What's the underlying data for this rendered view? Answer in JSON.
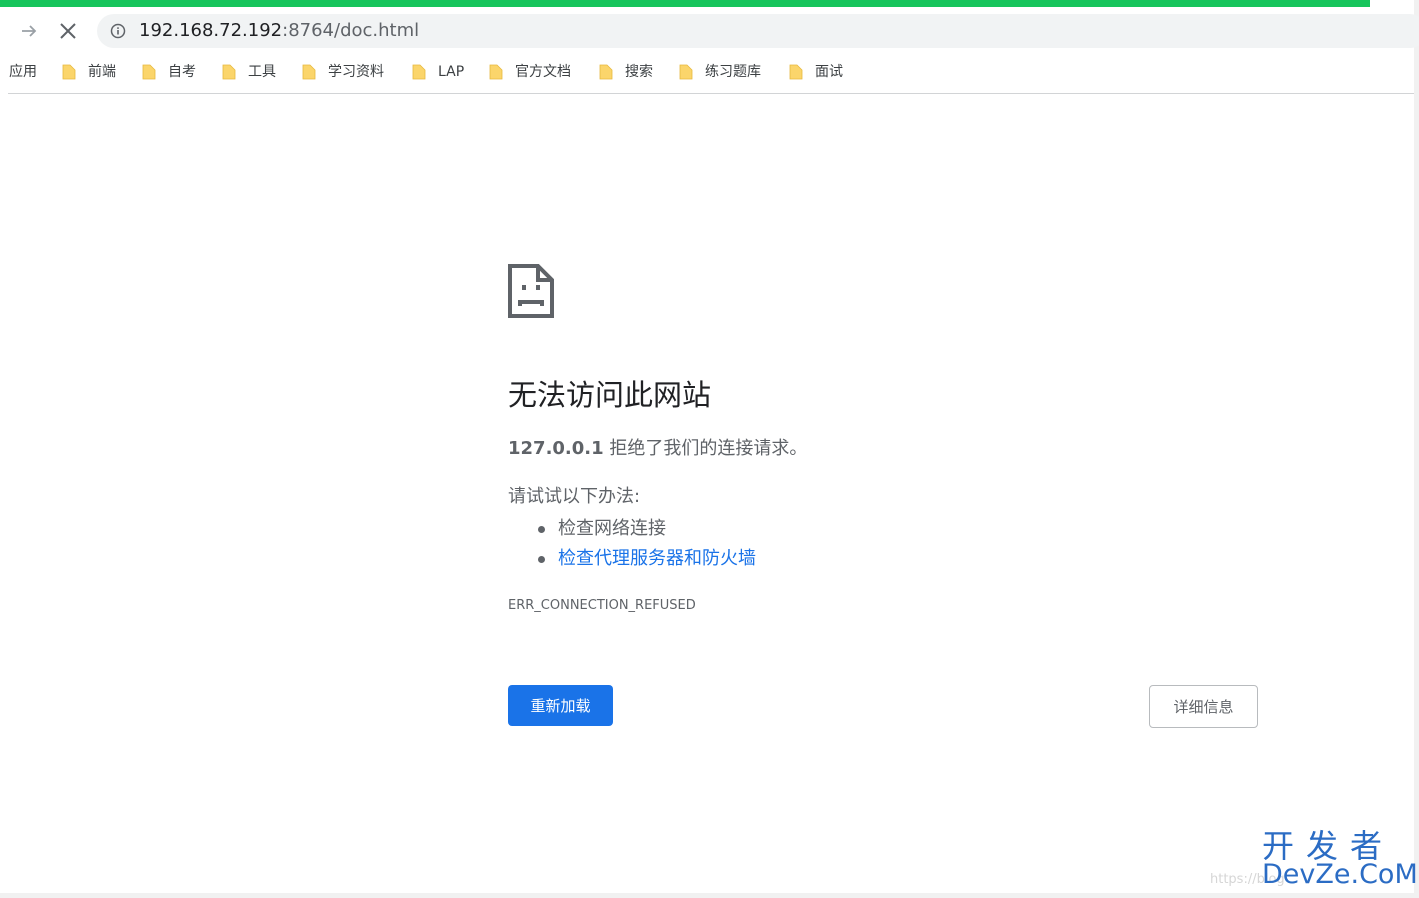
{
  "browser": {
    "address_host": "192.168.72.192",
    "address_rest": ":8764/doc.html"
  },
  "bookmarks": {
    "apps_label": "应用",
    "items": [
      {
        "label": "前端"
      },
      {
        "label": "自考"
      },
      {
        "label": "工具"
      },
      {
        "label": "学习资料"
      },
      {
        "label": "LAP"
      },
      {
        "label": "官方文档"
      },
      {
        "label": "搜索"
      },
      {
        "label": "练习题库"
      },
      {
        "label": "面试"
      }
    ]
  },
  "error": {
    "title": "无法访问此网站",
    "host": "127.0.0.1",
    "message": " 拒绝了我们的连接请求。",
    "try_label": "请试试以下办法:",
    "suggestions": [
      "检查网络连接",
      "检查代理服务器和防火墙"
    ],
    "code": "ERR_CONNECTION_REFUSED",
    "reload_label": "重新加载",
    "details_label": "详细信息"
  },
  "watermark": {
    "cn": "开发者",
    "url": "https://blog",
    "en": "DevZe.CoM"
  },
  "colors": {
    "progress": "#17c55c",
    "link": "#1a73e8",
    "watermark": "#2b6cc4"
  }
}
